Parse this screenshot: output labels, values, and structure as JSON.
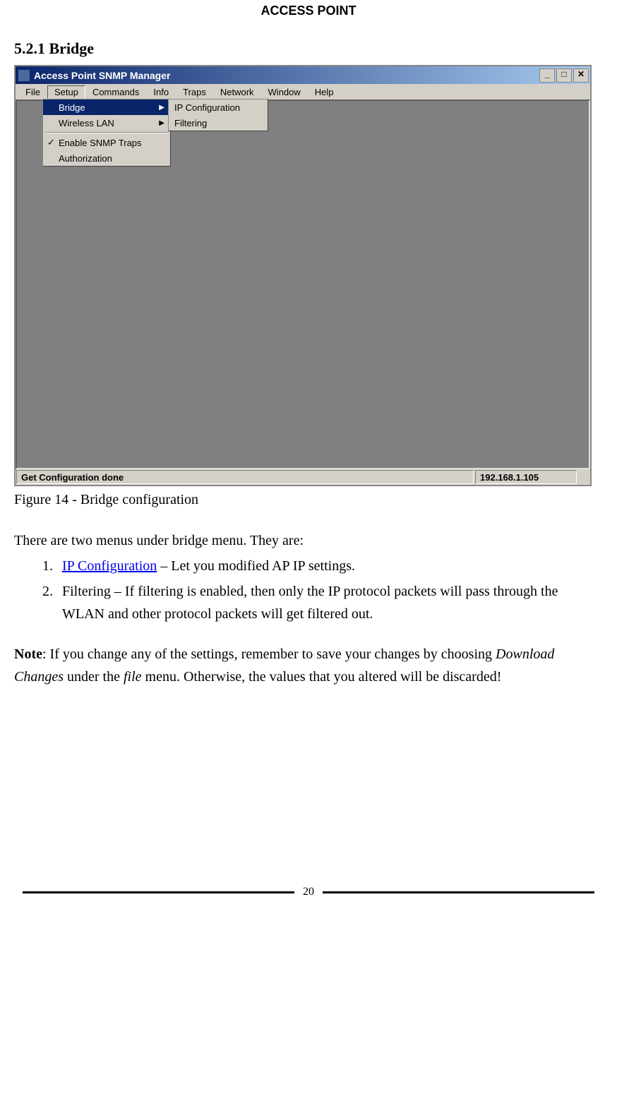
{
  "header": "ACCESS POINT",
  "section_heading": "5.2.1 Bridge",
  "window": {
    "title": "Access Point SNMP Manager",
    "menubar": {
      "file": "File",
      "setup": "Setup",
      "commands": "Commands",
      "info": "Info",
      "traps": "Traps",
      "network": "Network",
      "window": "Window",
      "help": "Help"
    },
    "dropdown": {
      "bridge": "Bridge",
      "wireless_lan": "Wireless LAN",
      "enable_snmp_traps": "Enable SNMP Traps",
      "authorization": "Authorization"
    },
    "submenu": {
      "ip_configuration": "IP Configuration",
      "filtering": "Filtering"
    },
    "status": {
      "message": "Get Configuration done",
      "ip": "192.168.1.105"
    },
    "title_buttons": {
      "minimize": "_",
      "maximize": "□",
      "close": "✕"
    }
  },
  "caption": "Figure 14 - Bridge configuration",
  "body": {
    "intro": "There are two menus under bridge menu. They are:",
    "item1_link": "IP Configuration",
    "item1_rest": " – Let you modified AP IP settings.",
    "item2": "Filtering – If filtering is enabled, then only the IP protocol packets will pass through the WLAN and other protocol packets will get filtered out.",
    "note_label": "Note",
    "note_text1": ": If you change any of the settings, remember to save your changes by choosing ",
    "note_italic1": "Download Changes",
    "note_text2": " under the ",
    "note_italic2": "file",
    "note_text3": " menu. Otherwise, the values that you altered will be discarded!"
  },
  "page_number": "20"
}
